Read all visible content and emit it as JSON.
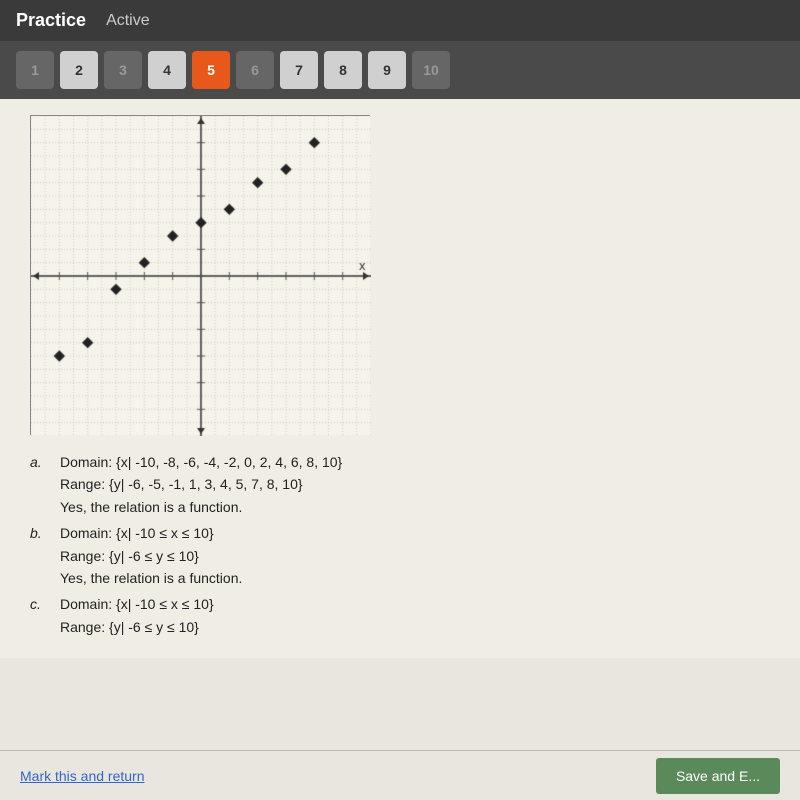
{
  "header": {
    "title": "Practice",
    "status": "Active"
  },
  "nav": {
    "buttons": [
      {
        "label": "1",
        "state": "dim"
      },
      {
        "label": "2",
        "state": "default"
      },
      {
        "label": "3",
        "state": "dim"
      },
      {
        "label": "4",
        "state": "default"
      },
      {
        "label": "5",
        "state": "active"
      },
      {
        "label": "6",
        "state": "dim"
      },
      {
        "label": "7",
        "state": "default"
      },
      {
        "label": "8",
        "state": "default"
      },
      {
        "label": "9",
        "state": "default"
      },
      {
        "label": "10",
        "state": "dim"
      }
    ]
  },
  "answers": {
    "a": {
      "letter": "a.",
      "lines": [
        "Domain: {x| -10, -8, -6, -4, -2, 0, 2, 4, 6, 8, 10}",
        "Range: {y| -6, -5, -1, 1, 3, 4, 5, 7, 8, 10}",
        "Yes, the relation is a function."
      ]
    },
    "b": {
      "letter": "b.",
      "lines": [
        "Domain: {x| -10 ≤ x ≤ 10}",
        "Range: {y| -6 ≤ y ≤ 10}",
        "Yes, the relation is a function."
      ]
    },
    "c": {
      "letter": "c.",
      "lines": [
        "Domain: {x| -10 ≤ x ≤ 10}",
        "Range: {y| -6 ≤ y ≤ 10}"
      ]
    }
  },
  "footer": {
    "mark_link": "Mark this and return",
    "save_btn": "Save and E..."
  },
  "graph": {
    "points": [
      [
        -10,
        -6
      ],
      [
        -8,
        -5
      ],
      [
        -6,
        -1
      ],
      [
        -4,
        1
      ],
      [
        -2,
        3
      ],
      [
        0,
        4
      ],
      [
        2,
        5
      ],
      [
        4,
        7
      ],
      [
        6,
        8
      ],
      [
        8,
        10
      ]
    ],
    "x_range": [
      -12,
      12
    ],
    "y_range": [
      -12,
      12
    ]
  }
}
